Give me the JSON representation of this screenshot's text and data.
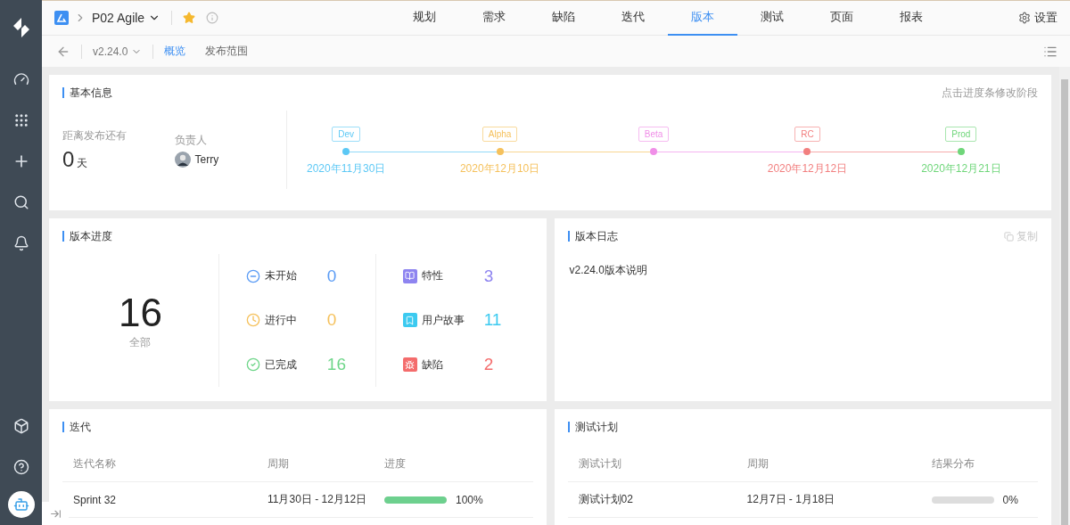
{
  "header": {
    "project": "P02 Agile",
    "starred": true,
    "nav": [
      {
        "label": "规划",
        "selected": false
      },
      {
        "label": "需求",
        "selected": false
      },
      {
        "label": "缺陷",
        "selected": false
      },
      {
        "label": "迭代",
        "selected": false
      },
      {
        "label": "版本",
        "selected": true
      },
      {
        "label": "测试",
        "selected": false
      },
      {
        "label": "页面",
        "selected": false
      },
      {
        "label": "报表",
        "selected": false
      }
    ],
    "settings": "设置"
  },
  "subbar": {
    "version": "v2.24.0",
    "tabs": [
      {
        "label": "概览",
        "selected": true
      },
      {
        "label": "发布范围",
        "selected": false
      }
    ]
  },
  "basic_info": {
    "title": "基本信息",
    "hint": "点击进度条修改阶段",
    "countdown_label": "距离发布还有",
    "countdown_value": "0",
    "countdown_unit": "天",
    "owner_label": "负责人",
    "owner": "Terry",
    "stages": [
      {
        "name": "Dev",
        "date": "2020年11月30日",
        "color": "#5cc8f5"
      },
      {
        "name": "Alpha",
        "date": "2020年12月10日",
        "color": "#f5c15c"
      },
      {
        "name": "Beta",
        "color": "#f08fe8"
      },
      {
        "name": "RC",
        "date": "2020年12月12日",
        "color": "#f27f7f"
      },
      {
        "name": "Prod",
        "date": "2020年12月21日",
        "color": "#6fd67a"
      }
    ]
  },
  "progress": {
    "title": "版本进度",
    "total": "16",
    "total_label": "全部",
    "statuses": [
      {
        "kind": "todo",
        "label": "未开始",
        "count": "0",
        "color": "#5b9cf5"
      },
      {
        "kind": "doing",
        "label": "进行中",
        "count": "0",
        "color": "#f5c15c"
      },
      {
        "kind": "done",
        "label": "已完成",
        "count": "16",
        "color": "#6fd68a"
      }
    ],
    "types": [
      {
        "kind": "feature",
        "label": "特性",
        "count": "3",
        "color": "#8e84f0"
      },
      {
        "kind": "story",
        "label": "用户故事",
        "count": "11",
        "color": "#3ccaf0"
      },
      {
        "kind": "bug",
        "label": "缺陷",
        "count": "2",
        "color": "#f46c6c"
      }
    ]
  },
  "log": {
    "title": "版本日志",
    "copy": "复制",
    "copy_disabled": true,
    "content": "v2.24.0版本说明"
  },
  "iterations": {
    "title": "迭代",
    "columns": [
      "迭代名称",
      "周期",
      "进度"
    ],
    "rows": [
      {
        "name": "Sprint 32",
        "period": "11月30日 - 12月12日",
        "level": 1,
        "reading": "100%"
      }
    ]
  },
  "test_plans": {
    "title": "测试计划",
    "columns": [
      "测试计划",
      "周期",
      "结果分布"
    ],
    "rows": [
      {
        "name": "测试计划02",
        "period": "12月7日 - 1月18日",
        "level": 0,
        "reading": "0%"
      }
    ]
  }
}
